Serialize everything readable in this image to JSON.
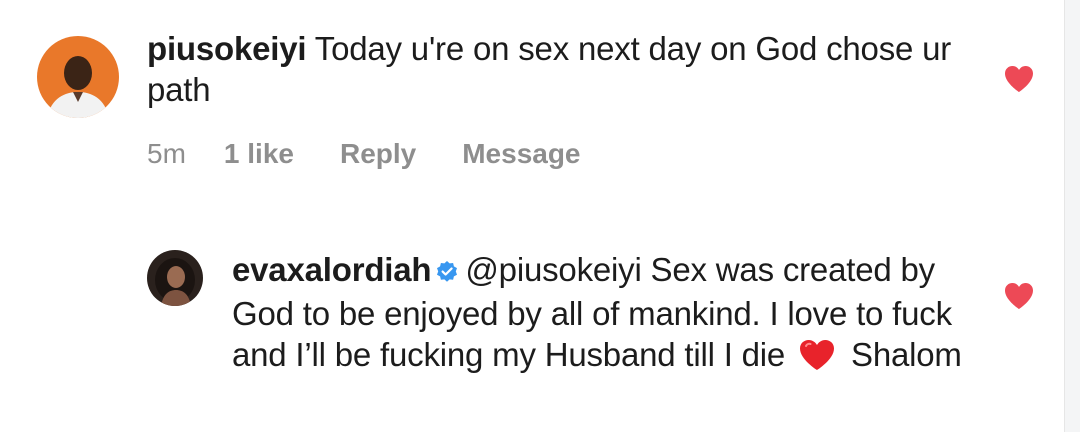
{
  "comment": {
    "username": "piusokeiyi",
    "text": " Today u're on sex next day on God chose ur path",
    "time": "5m",
    "likes": "1 like",
    "reply_label": "Reply",
    "message_label": "Message"
  },
  "reply": {
    "username": "evaxalordiah",
    "mention": "@piusokeiyi",
    "text": " Sex was created by God to be enjoyed by all of mankind. I love to fuck and I’ll be fucking my Husband till I die ",
    "closing": " Shalom"
  },
  "icons": {
    "like": "heart-icon",
    "verified": "verified-badge-icon",
    "emoji": "red-heart-emoji"
  },
  "colors": {
    "heart": "#ed4956",
    "verified": "#3897f0",
    "muted_text": "#8e8e8e",
    "text": "#1c1c1c",
    "avatar1_bg": "#e9782a"
  }
}
